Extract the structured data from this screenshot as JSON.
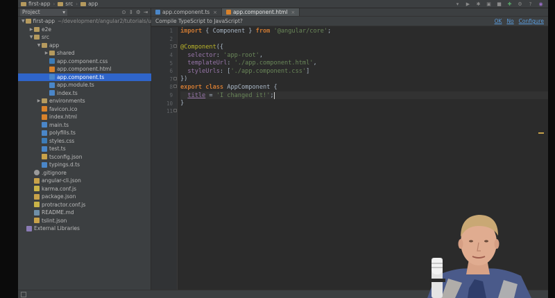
{
  "breadcrumbs": [
    "first-app",
    "src",
    "app"
  ],
  "project": {
    "dropdown_label": "Project",
    "tree": [
      {
        "label": "first-app",
        "path": "~/development/angular2/tutorials/u",
        "type": "folder",
        "depth": 0,
        "arrow": "▼"
      },
      {
        "label": "e2e",
        "type": "folder",
        "depth": 1,
        "arrow": "▶"
      },
      {
        "label": "src",
        "type": "folder",
        "depth": 1,
        "arrow": "▼"
      },
      {
        "label": "app",
        "type": "folder",
        "depth": 2,
        "arrow": "▼"
      },
      {
        "label": "shared",
        "type": "folder",
        "depth": 3,
        "arrow": "▶"
      },
      {
        "label": "app.component.css",
        "type": "css",
        "depth": 3
      },
      {
        "label": "app.component.html",
        "type": "html",
        "depth": 3
      },
      {
        "label": "app.component.ts",
        "type": "ts",
        "depth": 3,
        "selected": true
      },
      {
        "label": "app.module.ts",
        "type": "ts",
        "depth": 3
      },
      {
        "label": "index.ts",
        "type": "ts",
        "depth": 3
      },
      {
        "label": "environments",
        "type": "folder",
        "depth": 2,
        "arrow": "▶"
      },
      {
        "label": "favicon.ico",
        "type": "html",
        "depth": 2
      },
      {
        "label": "index.html",
        "type": "html",
        "depth": 2
      },
      {
        "label": "main.ts",
        "type": "ts",
        "depth": 2
      },
      {
        "label": "polyfills.ts",
        "type": "ts",
        "depth": 2
      },
      {
        "label": "styles.css",
        "type": "css",
        "depth": 2
      },
      {
        "label": "test.ts",
        "type": "ts",
        "depth": 2
      },
      {
        "label": "tsconfig.json",
        "type": "json",
        "depth": 2
      },
      {
        "label": "typings.d.ts",
        "type": "ts",
        "depth": 2
      },
      {
        "label": ".gitignore",
        "type": "git",
        "depth": 1
      },
      {
        "label": "angular-cli.json",
        "type": "json",
        "depth": 1
      },
      {
        "label": "karma.conf.js",
        "type": "js",
        "depth": 1
      },
      {
        "label": "package.json",
        "type": "json",
        "depth": 1
      },
      {
        "label": "protractor.conf.js",
        "type": "js",
        "depth": 1
      },
      {
        "label": "README.md",
        "type": "md",
        "depth": 1
      },
      {
        "label": "tslint.json",
        "type": "json",
        "depth": 1
      },
      {
        "label": "External Libraries",
        "type": "lib",
        "depth": 0
      }
    ]
  },
  "tabs": [
    {
      "label": "app.component.ts",
      "active": false
    },
    {
      "label": "app.component.html",
      "active": true
    }
  ],
  "notice": {
    "message": "Compile TypeScript to JavaScript?",
    "ok": "OK",
    "no": "No",
    "configure": "Configure"
  },
  "code": {
    "line_numbers": [
      "1",
      "2",
      "3",
      "4",
      "5",
      "6",
      "7",
      "8",
      "9",
      "10",
      "11"
    ],
    "l1": {
      "kw": "import",
      "t1": " { Component } ",
      "kw2": "from",
      "str": " '@angular/core'",
      "t2": ";"
    },
    "l3": {
      "ann": "@Component",
      "t": "({"
    },
    "l4": {
      "prop": "  selector",
      "t": ": ",
      "str": "'app-root'",
      "t2": ","
    },
    "l5": {
      "prop": "  templateUrl",
      "t": ": ",
      "str": "'./app.component.html'",
      "t2": ","
    },
    "l6": {
      "prop": "  styleUrls",
      "t": ": [",
      "str": "'./app.component.css'",
      "t2": "]"
    },
    "l7": {
      "t": "})"
    },
    "l8": {
      "kw": "export class",
      "t": " AppComponent {"
    },
    "l9": {
      "fld": "title",
      "t": " = ",
      "str": "'I changed it!'",
      "t2": ";"
    },
    "l10": {
      "t": "}"
    }
  },
  "colors": {
    "selection": "#2f65ca",
    "keyword": "#cc7832",
    "string": "#6a8759",
    "annotation": "#bbb529",
    "property": "#9876aa",
    "link": "#5a9bdb"
  }
}
